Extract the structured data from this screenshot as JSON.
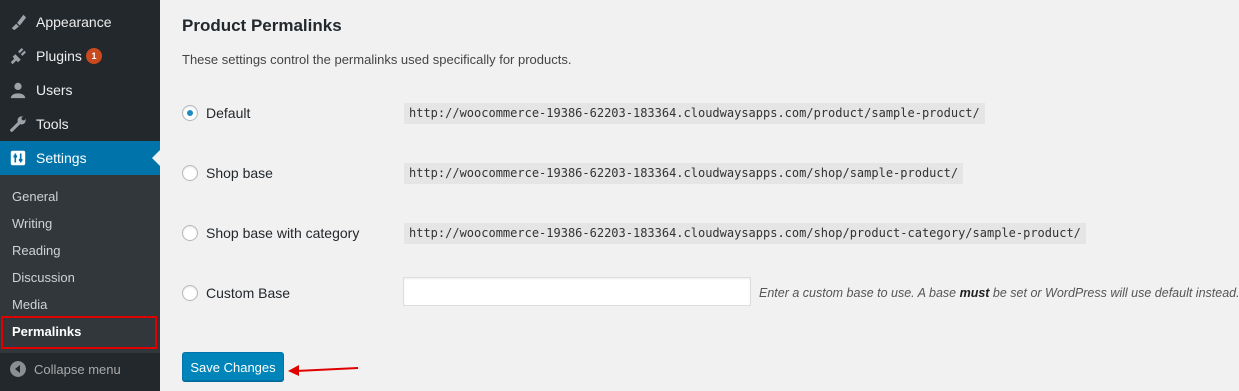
{
  "sidebar": {
    "items": [
      {
        "label": "Appearance",
        "icon": "brush-icon"
      },
      {
        "label": "Plugins",
        "icon": "plugin-icon",
        "badge": "1"
      },
      {
        "label": "Users",
        "icon": "users-icon"
      },
      {
        "label": "Tools",
        "icon": "wrench-icon"
      },
      {
        "label": "Settings",
        "icon": "settings-icon",
        "current": true
      }
    ],
    "submenu": [
      "General",
      "Writing",
      "Reading",
      "Discussion",
      "Media",
      "Permalinks"
    ],
    "current_submenu": "Permalinks",
    "collapse_label": "Collapse menu"
  },
  "main": {
    "title": "Product Permalinks",
    "description": "These settings control the permalinks used specifically for products.",
    "options": [
      {
        "label": "Default",
        "url": "http://woocommerce-19386-62203-183364.cloudwaysapps.com/product/sample-product/",
        "checked": true
      },
      {
        "label": "Shop base",
        "url": "http://woocommerce-19386-62203-183364.cloudwaysapps.com/shop/sample-product/",
        "checked": false
      },
      {
        "label": "Shop base with category",
        "url": "http://woocommerce-19386-62203-183364.cloudwaysapps.com/shop/product-category/sample-product/",
        "checked": false
      },
      {
        "label": "Custom Base",
        "checked": false
      }
    ],
    "custom_base_value": "",
    "hint_before": "Enter a custom base to use. A base ",
    "hint_bold": "must",
    "hint_after": " be set or WordPress will use default instead.",
    "save_label": "Save Changes"
  },
  "colors": {
    "sidebar_bg": "#23282d",
    "submenu_bg": "#32373c",
    "accent": "#0073aa",
    "button": "#0085ba",
    "badge": "#ca4a1f",
    "annotation_red": "#e00000"
  }
}
